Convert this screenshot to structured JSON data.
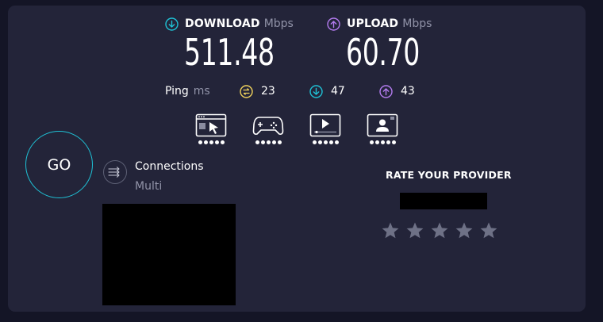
{
  "download": {
    "label": "DOWNLOAD",
    "unit": "Mbps",
    "value": "511.48",
    "icon": "download-arrow-icon",
    "color": "#1fc2d6"
  },
  "upload": {
    "label": "UPLOAD",
    "unit": "Mbps",
    "value": "60.70",
    "icon": "upload-arrow-icon",
    "color": "#b47cf0"
  },
  "ping": {
    "label": "Ping",
    "unit": "ms",
    "idle": {
      "value": "23",
      "icon": "idle-latency-icon",
      "color": "#f2d45c"
    },
    "download": {
      "value": "47",
      "icon": "download-latency-icon",
      "color": "#1fc2d6"
    },
    "upload": {
      "value": "43",
      "icon": "upload-latency-icon",
      "color": "#b47cf0"
    }
  },
  "apps": [
    {
      "name": "web-browsing-icon",
      "rating": 5
    },
    {
      "name": "gaming-icon",
      "rating": 5
    },
    {
      "name": "video-streaming-icon",
      "rating": 5
    },
    {
      "name": "video-chat-icon",
      "rating": 5
    }
  ],
  "go_button": {
    "label": "GO",
    "color": "#1fc2d6"
  },
  "connections": {
    "title": "Connections",
    "value": "Multi"
  },
  "rate": {
    "title": "RATE YOUR PROVIDER",
    "stars": 5
  },
  "colors": {
    "background": "#141526",
    "panel": "#232439",
    "muted": "#9193a8",
    "star": "#6e7186"
  }
}
